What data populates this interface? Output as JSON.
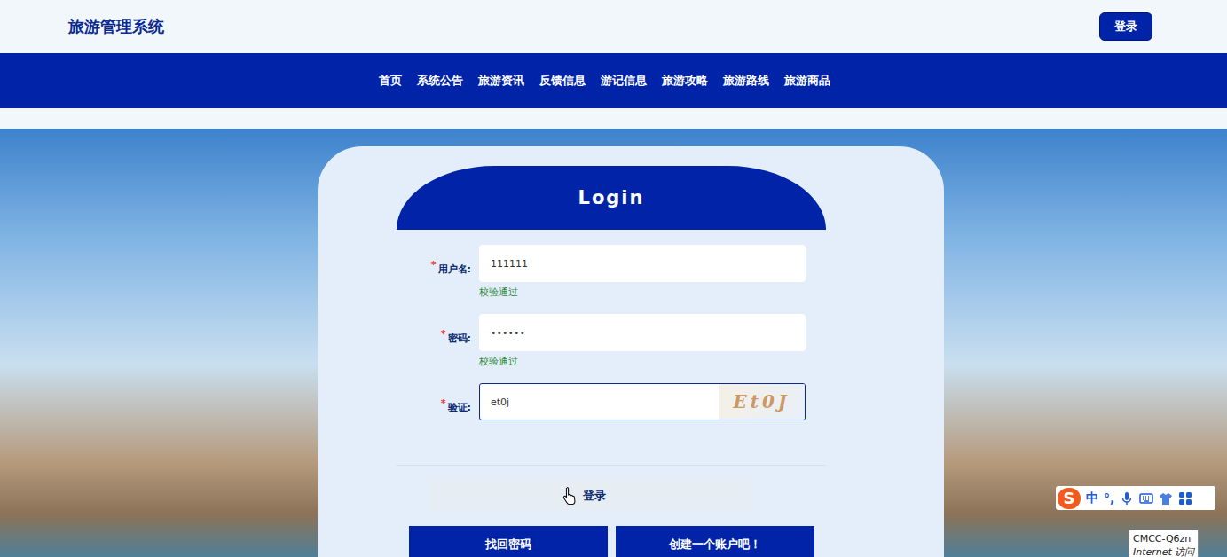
{
  "header": {
    "title": "旅游管理系统",
    "login_button": "登录"
  },
  "nav": [
    {
      "label": "首页",
      "selected": false
    },
    {
      "label": "系统公告",
      "selected": false
    },
    {
      "label": "旅游资讯",
      "selected": false
    },
    {
      "label": "反馈信息",
      "selected": false
    },
    {
      "label": "游记信息",
      "selected": false
    },
    {
      "label": "旅游攻略",
      "selected": false
    },
    {
      "label": "旅游路线",
      "selected": false
    },
    {
      "label": "旅游商品",
      "selected": false
    }
  ],
  "login": {
    "title": "Login",
    "fields": [
      {
        "label": "用户名:",
        "required": "*",
        "value": "111111",
        "hint": "校验通过",
        "kind": "text",
        "focused": false
      },
      {
        "label": "密码:",
        "required": "*",
        "value": "••••••",
        "hint": "校验通过",
        "kind": "text",
        "focused": false
      },
      {
        "label": "验证:",
        "required": "*",
        "value": "et0j",
        "hint": "",
        "kind": "captcha",
        "captcha": "Et0J",
        "focused": true
      }
    ],
    "submit": "登录",
    "buttons": [
      "找回密码",
      "创建一个账户吧！"
    ]
  },
  "ime_toolbar": {
    "logo": "S",
    "items": [
      "中",
      "°,"
    ]
  },
  "tooltip": {
    "lines": [
      "CMCC-Q6zn",
      "Internet 访问"
    ]
  }
}
